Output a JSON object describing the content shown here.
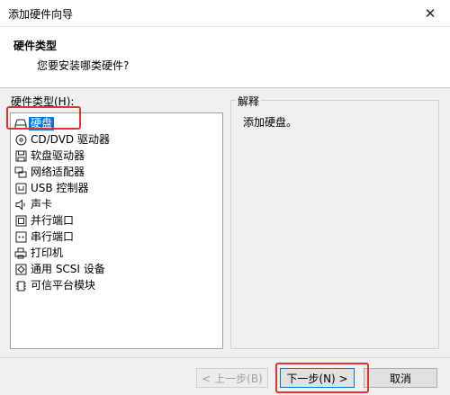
{
  "window": {
    "title": "添加硬件向导"
  },
  "header": {
    "title": "硬件类型",
    "subtitle": "您要安装哪类硬件?"
  },
  "hardware": {
    "label": "硬件类型(H):",
    "items": [
      {
        "label": "硬盘",
        "icon": "hard-disk-icon",
        "selected": true
      },
      {
        "label": "CD/DVD 驱动器",
        "icon": "cd-dvd-icon"
      },
      {
        "label": "软盘驱动器",
        "icon": "floppy-icon"
      },
      {
        "label": "网络适配器",
        "icon": "network-adapter-icon"
      },
      {
        "label": "USB 控制器",
        "icon": "usb-icon"
      },
      {
        "label": "声卡",
        "icon": "speaker-icon"
      },
      {
        "label": "并行端口",
        "icon": "parallel-port-icon"
      },
      {
        "label": "串行端口",
        "icon": "serial-port-icon"
      },
      {
        "label": "打印机",
        "icon": "printer-icon"
      },
      {
        "label": "通用 SCSI 设备",
        "icon": "scsi-icon"
      },
      {
        "label": "可信平台模块",
        "icon": "tpm-icon"
      }
    ]
  },
  "explain": {
    "title": "解释",
    "text": "添加硬盘。"
  },
  "buttons": {
    "back": "< 上一步(B)",
    "next": "下一步(N) >",
    "cancel": "取消"
  },
  "colors": {
    "selection": "#0078d7",
    "highlight": "#e8322d"
  }
}
